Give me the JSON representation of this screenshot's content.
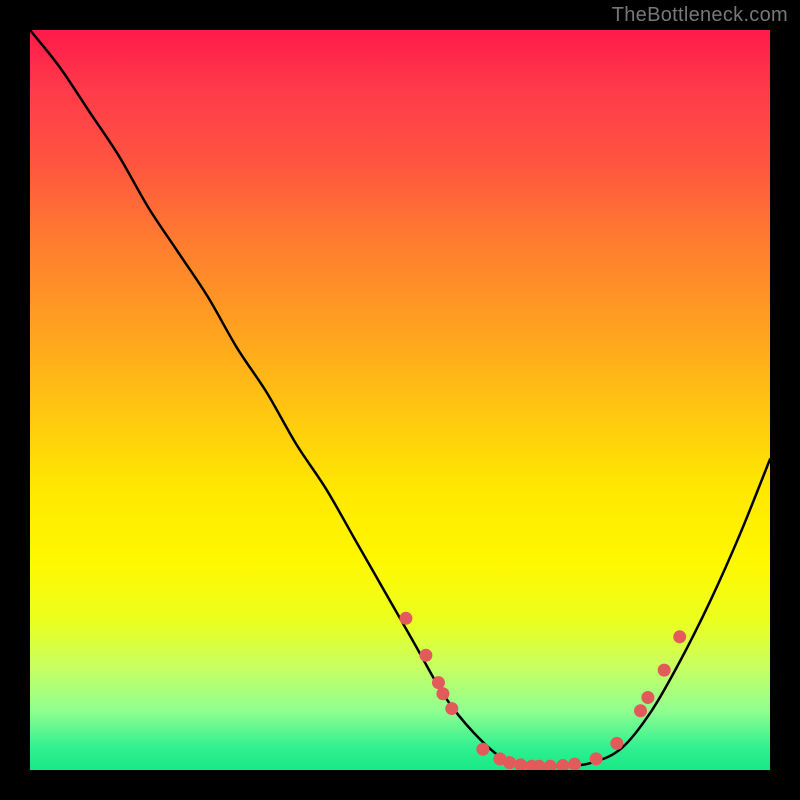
{
  "watermark": "TheBottleneck.com",
  "chart_data": {
    "type": "line",
    "title": "",
    "xlabel": "",
    "ylabel": "",
    "xlim": [
      0,
      100
    ],
    "ylim": [
      0,
      100
    ],
    "series": [
      {
        "name": "bottleneck-curve",
        "x_pct": [
          0,
          4,
          8,
          12,
          16,
          20,
          24,
          28,
          32,
          36,
          40,
          44,
          48,
          52,
          56,
          60,
          64,
          68,
          72,
          76,
          80,
          84,
          88,
          92,
          96,
          100
        ],
        "y_pct": [
          100,
          95,
          89,
          83,
          76,
          70,
          64,
          57,
          51,
          44,
          38,
          31,
          24,
          17,
          10,
          5,
          1.5,
          0.5,
          0.5,
          1,
          3,
          8,
          15,
          23,
          32,
          42
        ]
      }
    ],
    "markers": {
      "name": "highlighted-points",
      "color": "#e25a5a",
      "points": [
        {
          "x_pct": 50.8,
          "y_pct": 20.5
        },
        {
          "x_pct": 53.5,
          "y_pct": 15.5
        },
        {
          "x_pct": 55.2,
          "y_pct": 11.8
        },
        {
          "x_pct": 55.8,
          "y_pct": 10.3
        },
        {
          "x_pct": 57.0,
          "y_pct": 8.3
        },
        {
          "x_pct": 61.2,
          "y_pct": 2.8
        },
        {
          "x_pct": 63.5,
          "y_pct": 1.5
        },
        {
          "x_pct": 64.8,
          "y_pct": 1.0
        },
        {
          "x_pct": 66.3,
          "y_pct": 0.7
        },
        {
          "x_pct": 67.8,
          "y_pct": 0.5
        },
        {
          "x_pct": 68.8,
          "y_pct": 0.5
        },
        {
          "x_pct": 70.3,
          "y_pct": 0.5
        },
        {
          "x_pct": 72.0,
          "y_pct": 0.6
        },
        {
          "x_pct": 73.6,
          "y_pct": 0.8
        },
        {
          "x_pct": 76.5,
          "y_pct": 1.5
        },
        {
          "x_pct": 79.3,
          "y_pct": 3.6
        },
        {
          "x_pct": 82.5,
          "y_pct": 8.0
        },
        {
          "x_pct": 83.5,
          "y_pct": 9.8
        },
        {
          "x_pct": 85.7,
          "y_pct": 13.5
        },
        {
          "x_pct": 87.8,
          "y_pct": 18.0
        }
      ]
    },
    "gradient_colors": {
      "top": "#ff1a4a",
      "upper_mid": "#ff7a30",
      "mid": "#ffe800",
      "lower_mid": "#c8ff60",
      "bottom": "#18e888"
    }
  }
}
